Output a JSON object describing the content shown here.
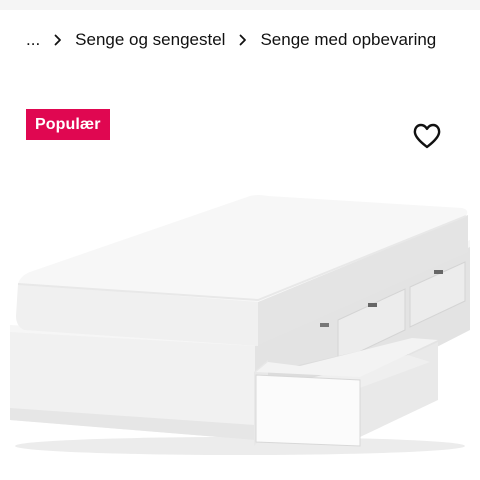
{
  "breadcrumb": {
    "items": [
      {
        "label": "..."
      },
      {
        "label": "Senge og sengestel"
      },
      {
        "label": "Senge med opbevaring"
      }
    ]
  },
  "badge": {
    "label": "Populær",
    "color": "#e00751"
  },
  "favorite": {
    "icon": "heart-icon"
  },
  "product": {
    "image": "bed-with-storage-drawers"
  }
}
